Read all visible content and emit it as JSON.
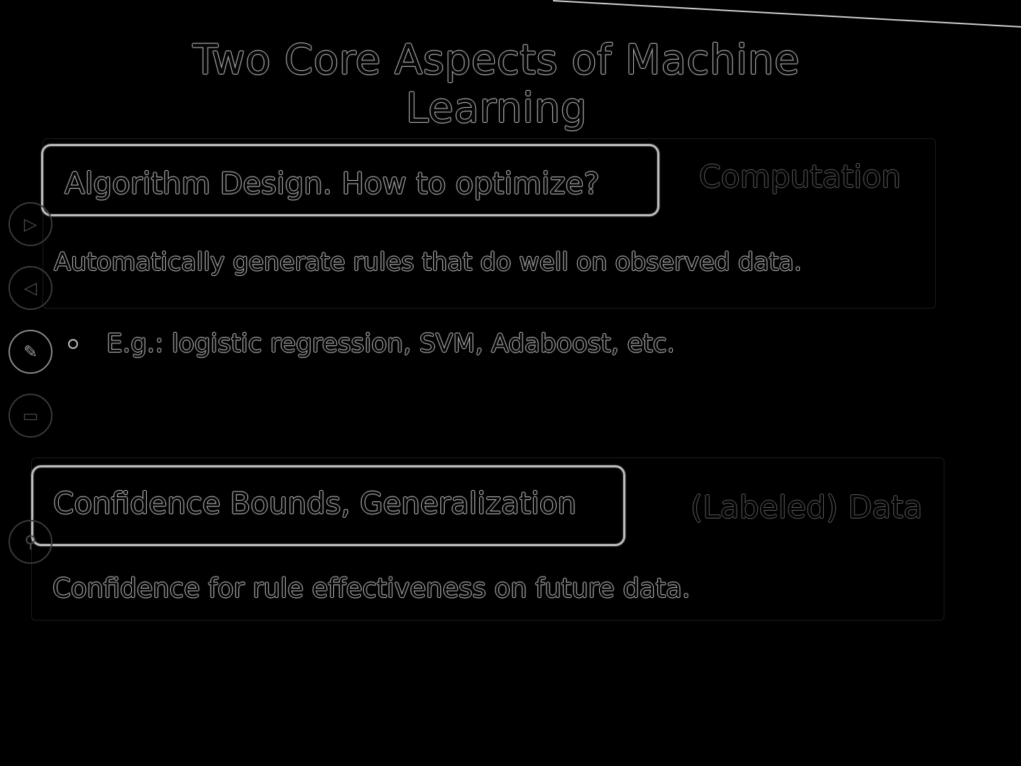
{
  "slide": {
    "title": "Two Core Aspects of Machine Learning",
    "section_algorithm": {
      "heading": "Algorithm Design. How to optimize?",
      "side_label": "Computation",
      "description": "Automatically generate rules that do well on observed data.",
      "bullet": "E.g.: logistic regression, SVM, Adaboost, etc."
    },
    "section_confidence": {
      "heading": "Confidence Bounds, Generalization",
      "side_label": "(Labeled) Data",
      "description": "Confidence for rule effectiveness on future data."
    }
  },
  "toolbar": {
    "tools": [
      {
        "icon": "play-icon",
        "glyph": "▷"
      },
      {
        "icon": "previous-icon",
        "glyph": "◁"
      },
      {
        "icon": "pen-icon",
        "glyph": "✎"
      },
      {
        "icon": "screen-icon",
        "glyph": "▭"
      },
      {
        "icon": "zoom-icon",
        "glyph": "⚲"
      }
    ]
  },
  "colors": {
    "background": "#000000",
    "outline": "#bdbdbd",
    "dim_outline": "#5a5a5a"
  }
}
